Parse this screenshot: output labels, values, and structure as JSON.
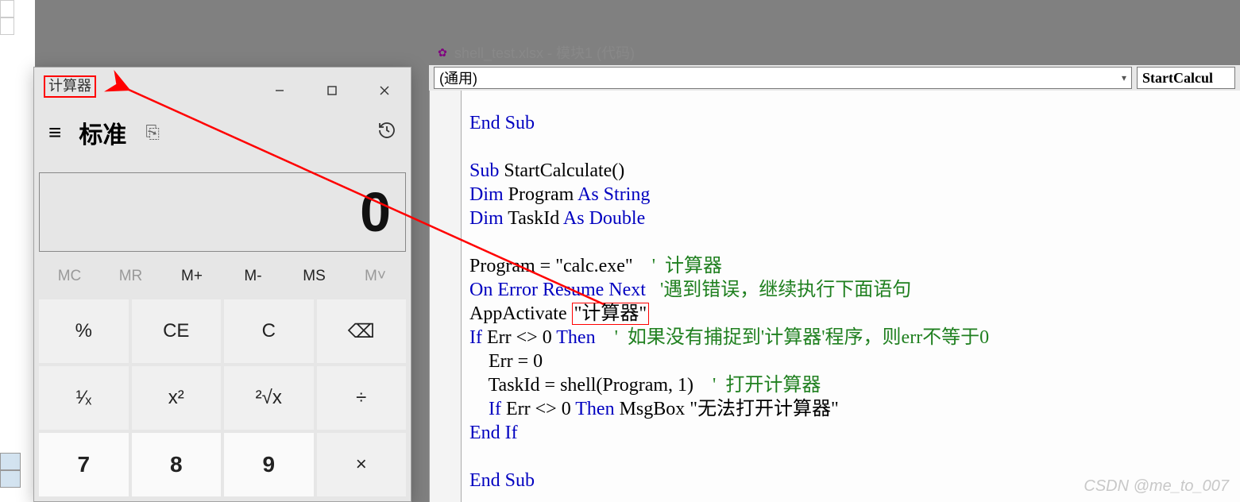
{
  "calc": {
    "title": "计算器",
    "mode": "标准",
    "display": "0",
    "mem": {
      "mc": "MC",
      "mr": "MR",
      "mplus": "M+",
      "mminus": "M-",
      "ms": "MS",
      "mlist": "M˅"
    },
    "btns": {
      "pct": "%",
      "ce": "CE",
      "c": "C",
      "back": "⌫",
      "inv": "¹⁄ₓ",
      "sq": "x²",
      "sqrt": "²√x",
      "div": "÷",
      "n7": "7",
      "n8": "8",
      "n9": "9",
      "mul": "×"
    }
  },
  "vba": {
    "title": "shell_test.xlsx - 模块1 (代码)",
    "combo1": "(通用)",
    "combo2": "StartCalcul",
    "code": {
      "l1a": "End Sub",
      "l3a": "Sub",
      "l3b": " StartCalculate()",
      "l4a": "Dim",
      "l4b": " Program ",
      "l4c": "As String",
      "l5a": "Dim",
      "l5b": " TaskId ",
      "l5c": "As Double",
      "l7a": "Program = \"calc.exe\"    ",
      "l7c": "'  计算器",
      "l8a": "On Error Resume Next",
      "l8b": "   ",
      "l8c": "'遇到错误，继续执行下面语句",
      "l9a": "AppActivate ",
      "l9b": "\"计算器\"",
      "l10a": "If",
      "l10b": " Err <> 0 ",
      "l10c": "Then",
      "l10d": "    ",
      "l10e": "'  如果没有捕捉到'计算器'程序，则err不等于0",
      "l11a": "    Err = 0",
      "l12a": "    TaskId = shell(Program, 1)    ",
      "l12c": "'  打开计算器",
      "l13a": "    ",
      "l13b": "If",
      "l13c": " Err <> 0 ",
      "l13d": "Then",
      "l13e": " MsgBox \"无法打开计算器\"",
      "l14a": "End If",
      "l16a": "End Sub"
    }
  },
  "watermark": "CSDN @me_to_007"
}
